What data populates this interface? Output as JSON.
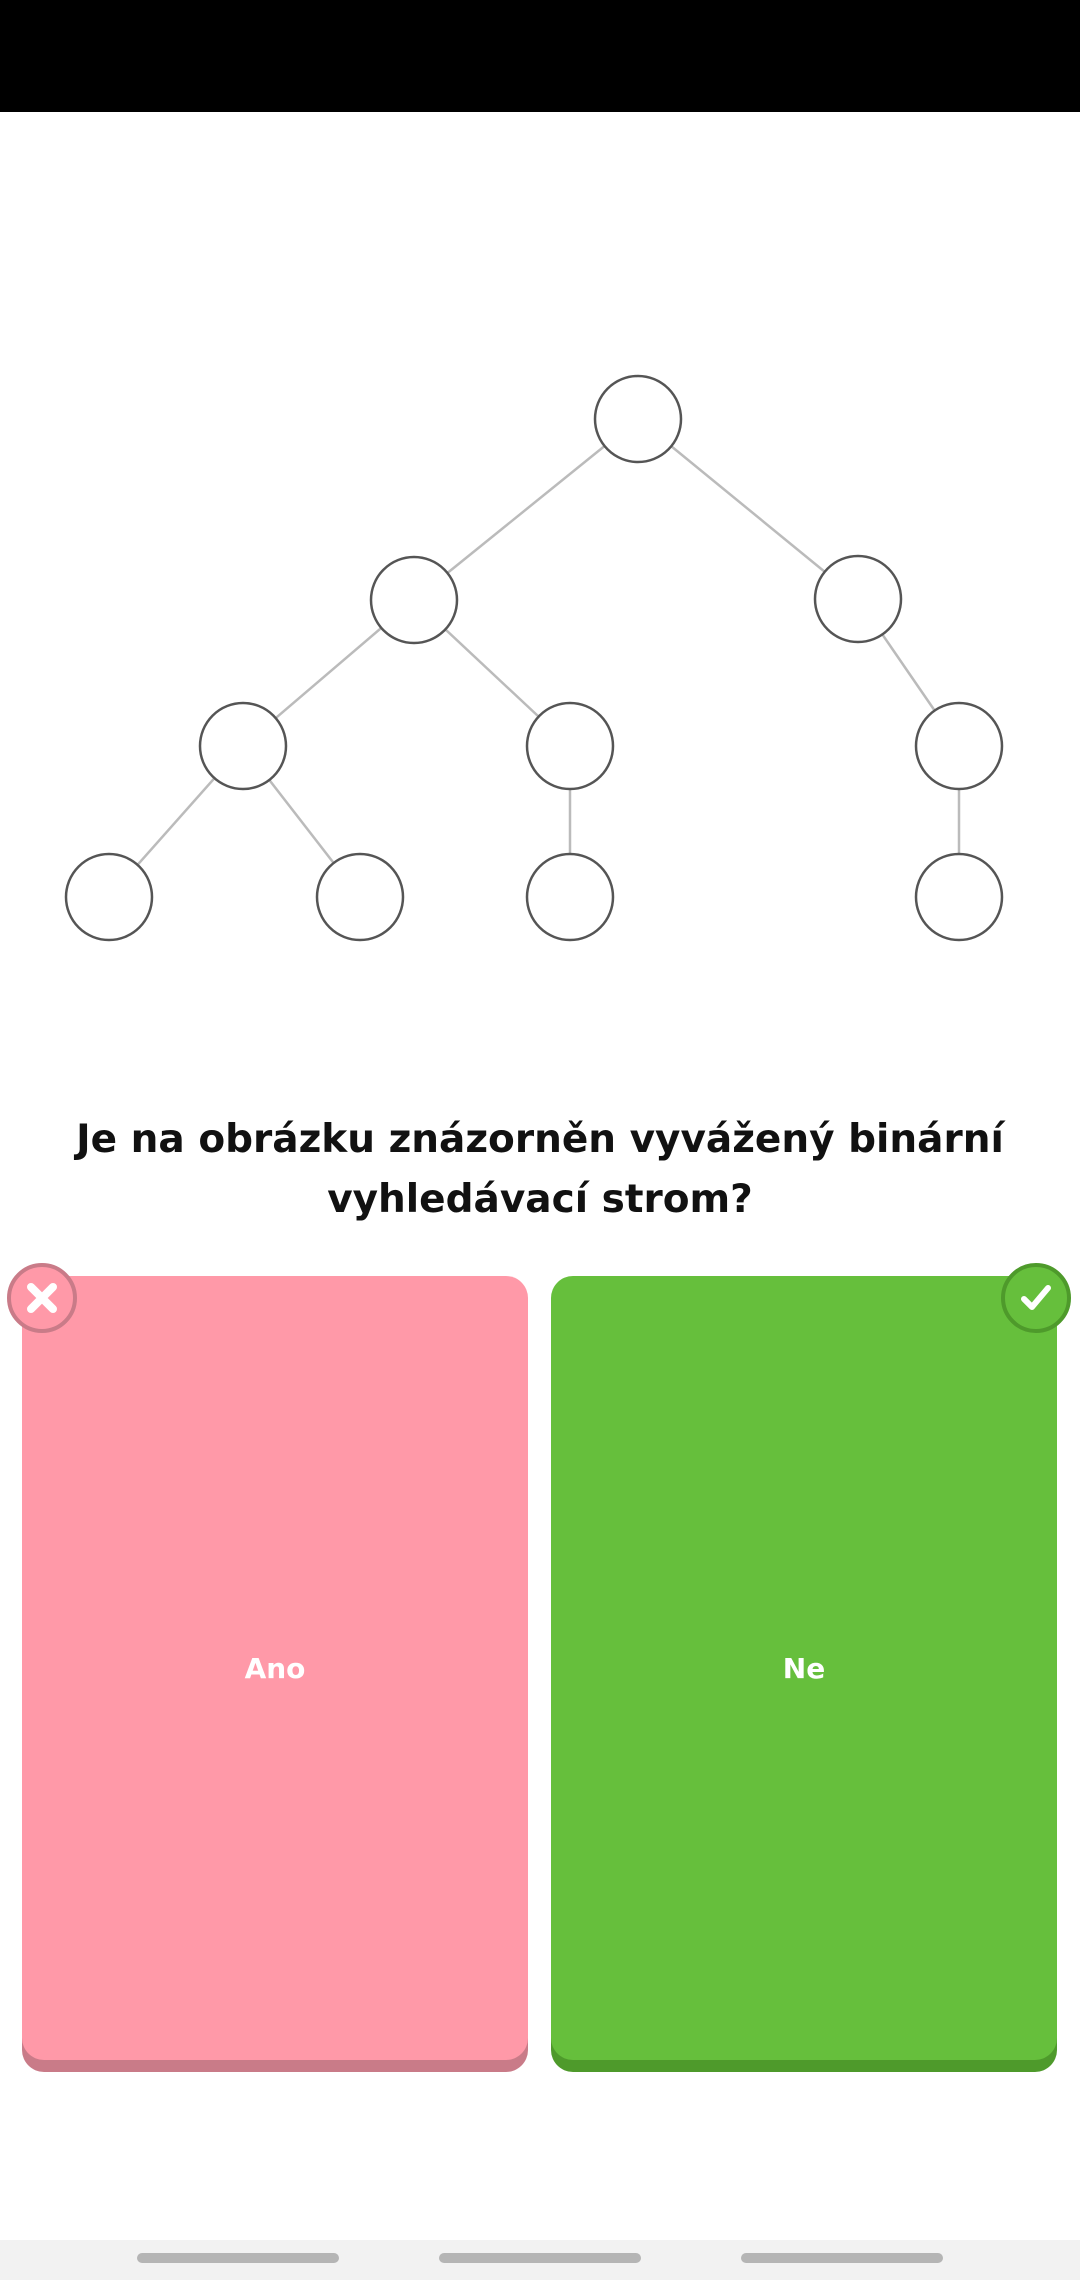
{
  "diagram": {
    "tree": {
      "children": [
        {
          "children": [
            {
              "children": [
                {
                  "children": []
                },
                {
                  "children": []
                }
              ]
            },
            {
              "children": [
                {
                  "children": []
                }
              ]
            }
          ]
        },
        {
          "children": [
            {
              "children": [
                {
                  "children": []
                }
              ]
            }
          ]
        }
      ]
    }
  },
  "question": "Je na obrázku znázorněn vyvážený binární vyhledávací strom?",
  "answers": [
    {
      "label": "Ano",
      "status": "wrong",
      "icon": "x-icon",
      "color": "#FF99A8"
    },
    {
      "label": "Ne",
      "status": "correct",
      "icon": "check-icon",
      "color": "#66BF3C"
    }
  ]
}
